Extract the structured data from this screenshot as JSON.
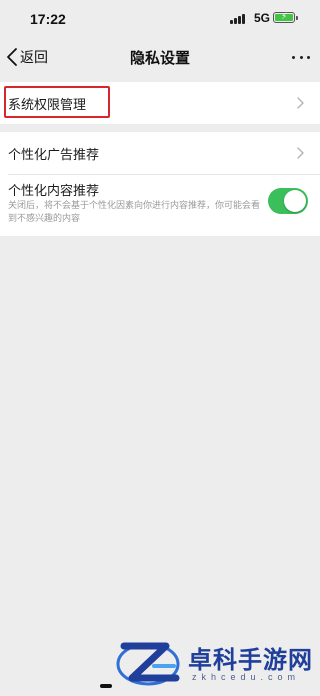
{
  "status_bar": {
    "time": "17:22",
    "network": "5G",
    "battery_level": 1.0,
    "battery_color": "#44c444"
  },
  "nav": {
    "back_label": "返回",
    "title": "隐私设置",
    "back_icon": "chevron-left-icon",
    "more_icon": "more-dots-icon"
  },
  "settings": {
    "system_permissions": {
      "label": "系统权限管理",
      "highlight_color": "#d8262c"
    },
    "personalized_ads": {
      "label": "个性化广告推荐"
    },
    "personalized_content": {
      "label": "个性化内容推荐",
      "description": "关闭后，将不会基于个性化因素向你进行内容推荐，你可能会看到不感兴趣的内容",
      "enabled": true,
      "toggle_color": "#3bbf5a"
    }
  },
  "watermark": {
    "title": "卓科手游网",
    "subtitle": "zkhcedu.com",
    "color": "#1f3f9a"
  }
}
